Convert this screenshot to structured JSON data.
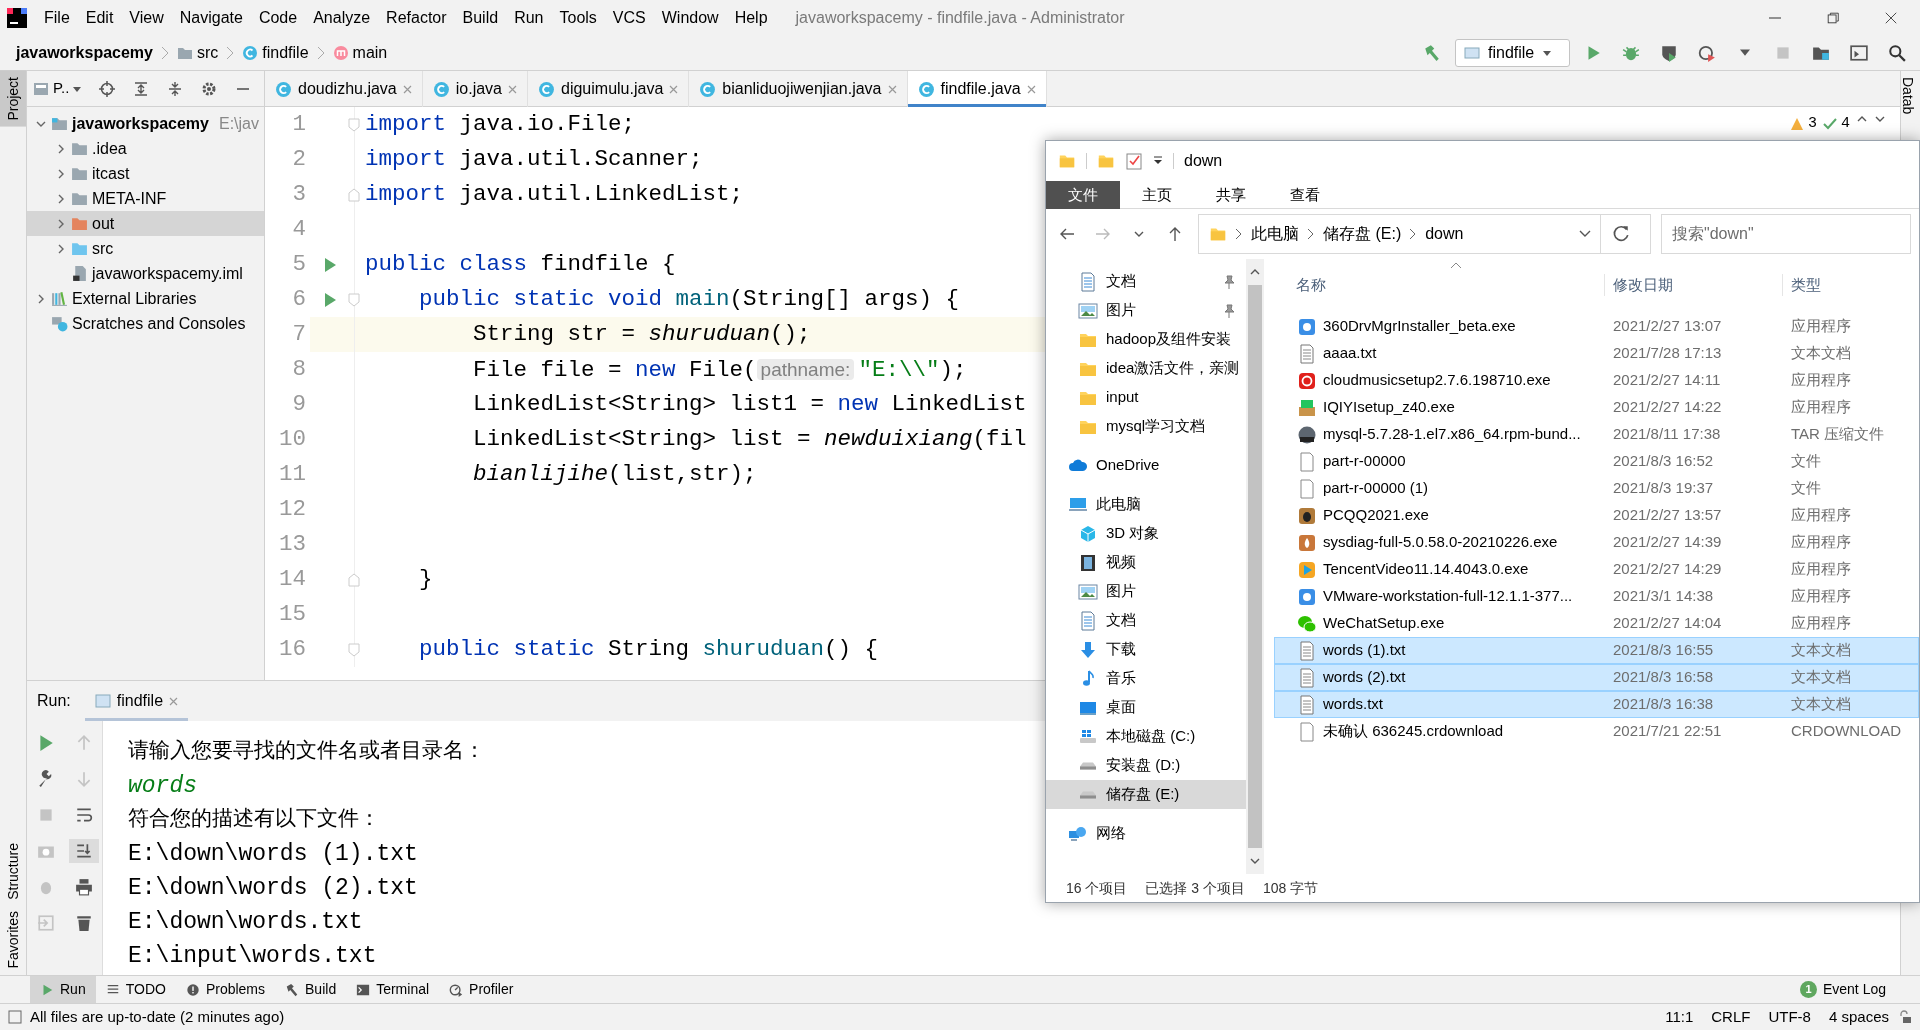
{
  "menu": [
    "File",
    "Edit",
    "View",
    "Navigate",
    "Code",
    "Analyze",
    "Refactor",
    "Build",
    "Run",
    "Tools",
    "VCS",
    "Window",
    "Help"
  ],
  "window_title": "javaworkspacemy - findfile.java - Administrator",
  "breadcrumb": [
    {
      "label": "javaworkspacemy",
      "kind": "project"
    },
    {
      "label": "src",
      "kind": "folder"
    },
    {
      "label": "findfile",
      "kind": "class"
    },
    {
      "label": "main",
      "kind": "method"
    }
  ],
  "run_config": "findfile",
  "side_tabs_left": {
    "top": "Project",
    "bottom": [
      "Structure",
      "Favorites"
    ]
  },
  "side_tab_right": "Datab",
  "project_view": {
    "selector": "P..",
    "tree": [
      {
        "label": "javaworkspacemy",
        "hint": "E:\\jav",
        "kind": "module",
        "expanded": true,
        "selected": false,
        "children": [
          {
            "label": ".idea",
            "kind": "folder",
            "expanded": false,
            "selected": false
          },
          {
            "label": "itcast",
            "kind": "folder",
            "expanded": false,
            "selected": false
          },
          {
            "label": "META-INF",
            "kind": "folder",
            "expanded": false,
            "selected": false
          },
          {
            "label": "out",
            "kind": "folder-excluded",
            "expanded": false,
            "selected": true
          },
          {
            "label": "src",
            "kind": "folder-source",
            "expanded": false,
            "selected": false
          },
          {
            "label": "javaworkspacemy.iml",
            "kind": "iml",
            "selected": false
          }
        ]
      },
      {
        "label": "External Libraries",
        "kind": "libraries",
        "expanded": false,
        "selected": false
      },
      {
        "label": "Scratches and Consoles",
        "kind": "scratches",
        "selected": false
      }
    ]
  },
  "editor_tabs": [
    {
      "label": "doudizhu.java",
      "selected": false
    },
    {
      "label": "io.java",
      "selected": false
    },
    {
      "label": "diguimulu.java",
      "selected": false
    },
    {
      "label": "bianliduojiwenjian.java",
      "selected": false
    },
    {
      "label": "findfile.java",
      "selected": true
    }
  ],
  "inspections": {
    "warnings": "3",
    "weak_warnings": "4"
  },
  "code": [
    {
      "n": "1",
      "run_marker": false,
      "fold_start": true,
      "fold_end": false,
      "current": false,
      "tokens": [
        {
          "text": "import",
          "kind": "kw"
        },
        {
          "text": " java.io.File;",
          "kind": "plain"
        }
      ]
    },
    {
      "n": "2",
      "run_marker": false,
      "fold_start": false,
      "fold_end": false,
      "current": false,
      "tokens": [
        {
          "text": "import",
          "kind": "kw"
        },
        {
          "text": " java.util.Scanner;",
          "kind": "plain"
        }
      ]
    },
    {
      "n": "3",
      "run_marker": false,
      "fold_start": false,
      "fold_end": true,
      "current": false,
      "tokens": [
        {
          "text": "import",
          "kind": "kw"
        },
        {
          "text": " java.util.LinkedList;",
          "kind": "plain"
        }
      ]
    },
    {
      "n": "4",
      "run_marker": false,
      "fold_start": false,
      "fold_end": false,
      "current": false
    },
    {
      "n": "5",
      "run_marker": true,
      "fold_start": false,
      "fold_end": false,
      "current": false,
      "tokens": [
        {
          "text": "public class ",
          "kind": "kw"
        },
        {
          "text": "findfile",
          "kind": "plain"
        },
        {
          "text": " {",
          "kind": "plain"
        }
      ]
    },
    {
      "n": "6",
      "run_marker": true,
      "fold_start": true,
      "fold_end": false,
      "current": false,
      "tokens": [
        {
          "text": "    public static void ",
          "kind": "kw"
        },
        {
          "text": "main",
          "kind": "decl"
        },
        {
          "text": "(String[] args) {",
          "kind": "plain"
        }
      ]
    },
    {
      "n": "7",
      "run_marker": false,
      "fold_start": false,
      "fold_end": false,
      "current": true,
      "tokens": [
        {
          "text": "        String str = ",
          "kind": "plain"
        },
        {
          "text": "shuruduan",
          "kind": "italic"
        },
        {
          "text": "();",
          "kind": "plain"
        }
      ]
    },
    {
      "n": "8",
      "run_marker": false,
      "fold_start": false,
      "fold_end": false,
      "current": false,
      "tokens": [
        {
          "text": "        File file = ",
          "kind": "plain"
        },
        {
          "text": "new",
          "kind": "kw"
        },
        {
          "text": " File(",
          "kind": "plain"
        },
        {
          "text": "pathname:",
          "kind": "hint"
        },
        {
          "text": "\"E:\\\\\"",
          "kind": "string"
        },
        {
          "text": ");",
          "kind": "plain"
        }
      ]
    },
    {
      "n": "9",
      "run_marker": false,
      "fold_start": false,
      "fold_end": false,
      "current": false,
      "tokens": [
        {
          "text": "        LinkedList<String> list1 = ",
          "kind": "plain"
        },
        {
          "text": "new",
          "kind": "kw"
        },
        {
          "text": " LinkedList",
          "kind": "plain"
        }
      ]
    },
    {
      "n": "10",
      "run_marker": false,
      "fold_start": false,
      "fold_end": false,
      "current": false,
      "tokens": [
        {
          "text": "        LinkedList<String> list = ",
          "kind": "plain"
        },
        {
          "text": "newduixiang",
          "kind": "italic"
        },
        {
          "text": "(fil",
          "kind": "plain"
        }
      ]
    },
    {
      "n": "11",
      "run_marker": false,
      "fold_start": false,
      "fold_end": false,
      "current": false,
      "tokens": [
        {
          "text": "        bianlijihe",
          "kind": "italic"
        },
        {
          "text": "(list,str);",
          "kind": "plain"
        }
      ]
    },
    {
      "n": "12",
      "run_marker": false,
      "fold_start": false,
      "fold_end": false,
      "current": false
    },
    {
      "n": "13",
      "run_marker": false,
      "fold_start": false,
      "fold_end": false,
      "current": false
    },
    {
      "n": "14",
      "run_marker": false,
      "fold_start": false,
      "fold_end": true,
      "current": false,
      "tokens": [
        {
          "text": "    }",
          "kind": "plain"
        }
      ]
    },
    {
      "n": "15",
      "run_marker": false,
      "fold_start": false,
      "fold_end": false,
      "current": false
    },
    {
      "n": "16",
      "run_marker": false,
      "fold_start": true,
      "fold_end": false,
      "current": false,
      "tokens": [
        {
          "text": "    public static ",
          "kind": "kw"
        },
        {
          "text": "String ",
          "kind": "plain"
        },
        {
          "text": "shuruduan",
          "kind": "decl"
        },
        {
          "text": "() {",
          "kind": "plain"
        }
      ]
    }
  ],
  "run_panel": {
    "label": "Run:",
    "tab": "findfile",
    "output": [
      {
        "text": "请输入您要寻找的文件名或者目录名：",
        "kind": "message"
      },
      {
        "text": "words",
        "kind": "input"
      },
      {
        "text": "符合您的描述有以下文件：",
        "kind": "message"
      },
      {
        "text": "E:\\down\\words (1).txt",
        "kind": "path"
      },
      {
        "text": "E:\\down\\words (2).txt",
        "kind": "path"
      },
      {
        "text": "E:\\down\\words.txt",
        "kind": "path"
      },
      {
        "text": "E:\\input\\words.txt",
        "kind": "path"
      }
    ]
  },
  "tool_tabs": [
    {
      "label": "Run",
      "kind": "run",
      "selected": true
    },
    {
      "label": "TODO",
      "kind": "list",
      "selected": false
    },
    {
      "label": "Problems",
      "kind": "problems",
      "selected": false
    },
    {
      "label": "Build",
      "kind": "hammer",
      "selected": false
    },
    {
      "label": "Terminal",
      "kind": "terminal",
      "selected": false
    },
    {
      "label": "Profiler",
      "kind": "profiler",
      "selected": false
    }
  ],
  "event_log": {
    "label": "Event Log",
    "count": "1"
  },
  "status_bar": {
    "message": "All files are up-to-date (2 minutes ago)",
    "items": [
      "11:1",
      "CRLF",
      "UTF-8",
      "4 spaces"
    ]
  },
  "explorer": {
    "title": "down",
    "ribbon_tabs": [
      {
        "label": "文件",
        "selected": true
      },
      {
        "label": "主页",
        "selected": false
      },
      {
        "label": "共享",
        "selected": false
      },
      {
        "label": "查看",
        "selected": false
      }
    ],
    "path": [
      "此电脑",
      "储存盘 (E:)",
      "down"
    ],
    "search": {
      "placeholder": "搜索\"down\""
    },
    "quick_access": [
      {
        "label": "文档",
        "kind": "doc",
        "pinned": true,
        "selected": false
      },
      {
        "label": "图片",
        "kind": "picture",
        "pinned": true,
        "selected": false
      },
      {
        "label": "hadoop及组件安装",
        "kind": "folder",
        "pinned": false,
        "selected": false
      },
      {
        "label": "idea激活文件，亲测",
        "kind": "folder",
        "pinned": false,
        "selected": false
      },
      {
        "label": "input",
        "kind": "folder",
        "pinned": false,
        "selected": false
      },
      {
        "label": "mysql学习文档",
        "kind": "folder",
        "pinned": false,
        "selected": false
      }
    ],
    "nav": [
      {
        "label": "OneDrive",
        "kind": "cloud",
        "selected": false
      },
      {
        "label": "此电脑",
        "kind": "pc",
        "selected": false,
        "children": [
          {
            "label": "3D 对象",
            "kind": "cube",
            "selected": false
          },
          {
            "label": "视频",
            "kind": "video",
            "selected": false
          },
          {
            "label": "图片",
            "kind": "picture",
            "selected": false
          },
          {
            "label": "文档",
            "kind": "doc",
            "selected": false
          },
          {
            "label": "下载",
            "kind": "download",
            "selected": false
          },
          {
            "label": "音乐",
            "kind": "music",
            "selected": false
          },
          {
            "label": "桌面",
            "kind": "desktop",
            "selected": false
          },
          {
            "label": "本地磁盘 (C:)",
            "kind": "drive-win",
            "selected": false
          },
          {
            "label": "安装盘 (D:)",
            "kind": "drive",
            "selected": false
          },
          {
            "label": "储存盘 (E:)",
            "kind": "drive",
            "selected": true
          }
        ]
      },
      {
        "label": "网络",
        "kind": "network",
        "selected": false
      }
    ],
    "columns": [
      "名称",
      "修改日期",
      "类型"
    ],
    "files": [
      {
        "name": "360DrvMgrInstaller_beta.exe",
        "date": "2021/2/27 13:07",
        "type": "应用程序",
        "kind": "app-blue",
        "selected": false
      },
      {
        "name": "aaaa.txt",
        "date": "2021/7/28 17:13",
        "type": "文本文档",
        "kind": "txt",
        "selected": false
      },
      {
        "name": "cloudmusicsetup2.7.6.198710.exe",
        "date": "2021/2/27 14:11",
        "type": "应用程序",
        "kind": "disc",
        "selected": false
      },
      {
        "name": "IQIYIsetup_z40.exe",
        "date": "2021/2/27 14:22",
        "type": "应用程序",
        "kind": "box",
        "selected": false
      },
      {
        "name": "mysql-5.7.28-1.el7.x86_64.rpm-bund...",
        "date": "2021/8/11 17:38",
        "type": "TAR 压缩文件",
        "kind": "archive",
        "selected": false
      },
      {
        "name": "part-r-00000",
        "date": "2021/8/3 16:52",
        "type": "文件",
        "kind": "file",
        "selected": false
      },
      {
        "name": "part-r-00000 (1)",
        "date": "2021/8/3 19:37",
        "type": "文件",
        "kind": "file",
        "selected": false
      },
      {
        "name": "PCQQ2021.exe",
        "date": "2021/2/27 13:57",
        "type": "应用程序",
        "kind": "app-brown",
        "selected": false
      },
      {
        "name": "sysdiag-full-5.0.58.0-20210226.exe",
        "date": "2021/2/27 14:39",
        "type": "应用程序",
        "kind": "app-orange",
        "selected": false
      },
      {
        "name": "TencentVideo11.14.4043.0.exe",
        "date": "2021/2/27 14:29",
        "type": "应用程序",
        "kind": "play",
        "selected": false
      },
      {
        "name": "VMware-workstation-full-12.1.1-377...",
        "date": "2021/3/1 14:38",
        "type": "应用程序",
        "kind": "app-blue",
        "selected": false
      },
      {
        "name": "WeChatSetup.exe",
        "date": "2021/2/27 14:04",
        "type": "应用程序",
        "kind": "chat",
        "selected": false
      },
      {
        "name": "words (1).txt",
        "date": "2021/8/3 16:55",
        "type": "文本文档",
        "kind": "txt",
        "selected": true
      },
      {
        "name": "words (2).txt",
        "date": "2021/8/3 16:58",
        "type": "文本文档",
        "kind": "txt",
        "selected": true
      },
      {
        "name": "words.txt",
        "date": "2021/8/3 16:38",
        "type": "文本文档",
        "kind": "txt",
        "selected": true
      },
      {
        "name": "未确认 636245.crdownload",
        "date": "2021/7/21 22:51",
        "type": "CRDOWNLOAD",
        "kind": "file",
        "selected": false
      }
    ],
    "status": [
      "16 个项目",
      "已选择 3 个项目",
      "108 字节"
    ]
  }
}
